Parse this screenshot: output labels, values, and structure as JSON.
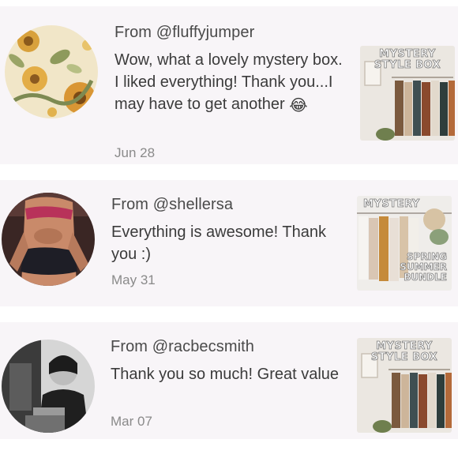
{
  "reviews": [
    {
      "author": "From @fluffyjumper",
      "message": "Wow, what a lovely mystery box. I liked everything! Thank you...I may have to get another",
      "emoji": "😂",
      "date": "Jun 28",
      "avatar_icon": "sunflower-avatar",
      "thumbnail": {
        "title": "MYSTERY STYLE BOX",
        "subtitle": ""
      }
    },
    {
      "author": "From @shellersa",
      "message": "Everything is awesome! Thank you :)",
      "emoji": "",
      "date": "May 31",
      "avatar_icon": "person-avatar",
      "thumbnail": {
        "title": "MYSTERY",
        "subtitle": "SPRING SUMMER BUNDLE"
      }
    },
    {
      "author": "From @racbecsmith",
      "message": "Thank you so much! Great value",
      "emoji": "",
      "date": "Mar 07",
      "avatar_icon": "person-avatar",
      "thumbnail": {
        "title": "MYSTERY STYLE BOX",
        "subtitle": ""
      }
    }
  ],
  "colors": {
    "card_bg": "#f8f5f8",
    "page_bg": "#ffffff",
    "author_text": "#4a4a4a",
    "date_text": "#8a8a8a"
  }
}
